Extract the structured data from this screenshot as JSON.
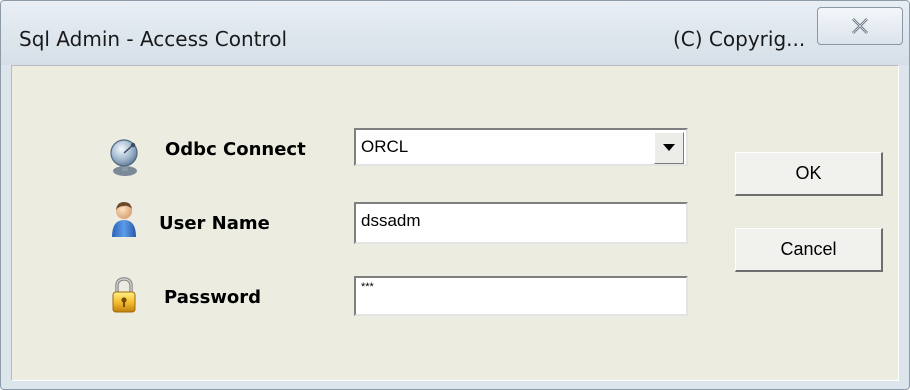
{
  "window": {
    "title": "Sql Admin - Access Control",
    "copyright": "(C) Copyrig..."
  },
  "form": {
    "odbc": {
      "label": "Odbc Connect",
      "value": "ORCL",
      "icon": "satellite-dish-icon"
    },
    "user": {
      "label": "User Name",
      "value": "dssadm",
      "icon": "user-icon"
    },
    "password": {
      "label": "Password",
      "value": "***",
      "icon": "lock-icon"
    }
  },
  "buttons": {
    "ok": "OK",
    "cancel": "Cancel"
  },
  "colors": {
    "client_background": "#ecece1",
    "titlebar": "#dce4ec"
  }
}
